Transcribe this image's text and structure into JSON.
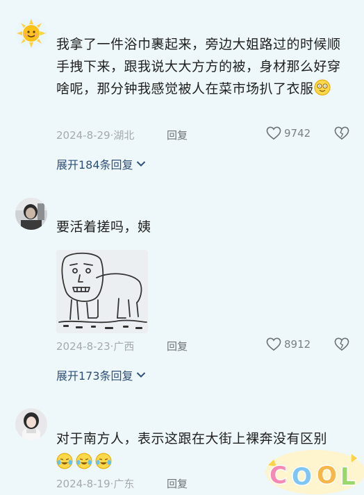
{
  "comments": [
    {
      "text": "我拿了一件浴巾裹起来，旁边大姐路过的时候顺手拽下来，跟我说大大方方的被，身材那么好穿啥呢，那分钟我感觉被人在菜市场扒了衣服",
      "date": "2024-8-29",
      "location": "湖北",
      "reply_label": "回复",
      "likes": "9742",
      "expand_label": "展开184条回复",
      "avatar_icon": "sun-avatar",
      "trailing_emoji": "dizzy-smile-emoji"
    },
    {
      "text": "要活着搓吗，姨",
      "date": "2024-8-23",
      "location": "广西",
      "reply_label": "回复",
      "likes": "8912",
      "expand_label": "展开173条回复",
      "avatar_icon": "person-photo-avatar",
      "image": "hand-drawn-sketch"
    },
    {
      "text": "对于南方人，表示这跟在大街上裸奔没有区别",
      "date": "2024-8-19",
      "location": "广东",
      "reply_label": "回复",
      "avatar_icon": "girl-photo-avatar",
      "trailing_emoji": "crying-laugh-emoji"
    }
  ],
  "sticker": "COOL",
  "colors": {
    "background": "#eef8fa",
    "link": "#2f4f77",
    "meta": "#a5a9ad"
  }
}
